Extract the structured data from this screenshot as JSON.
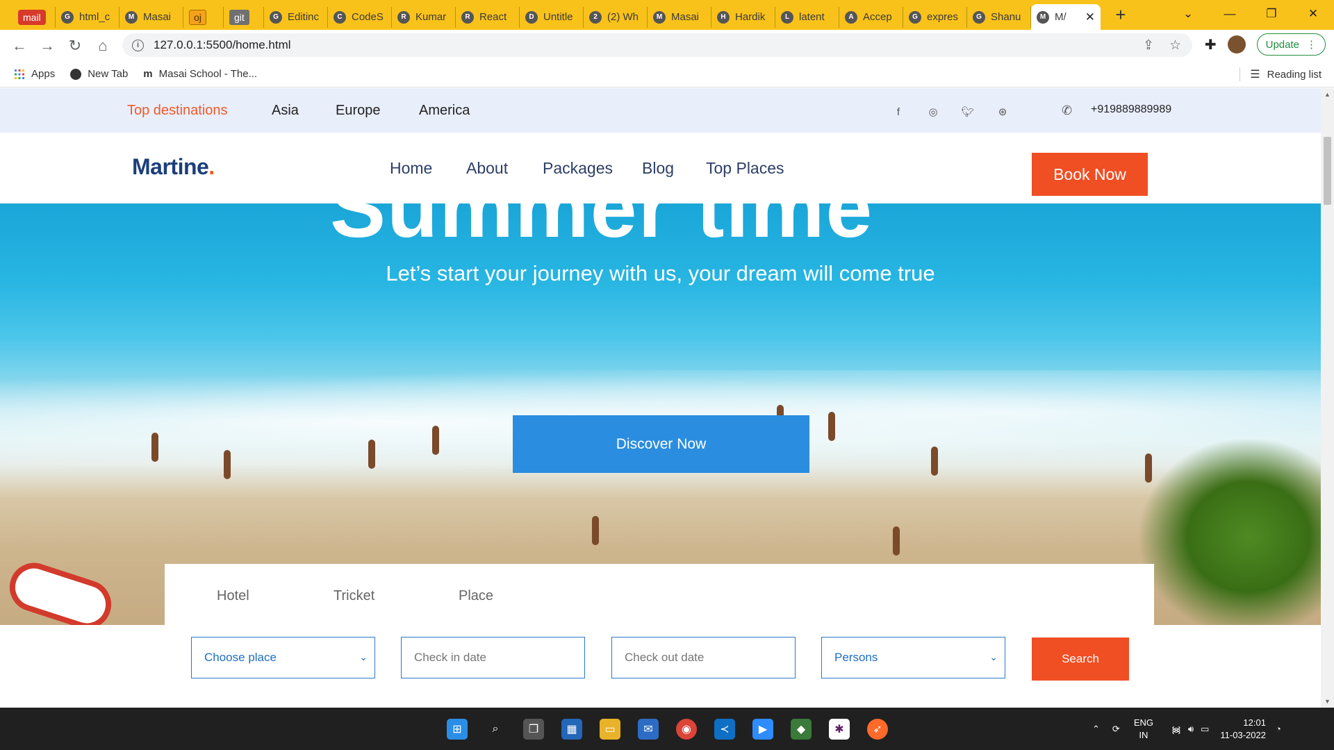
{
  "browser": {
    "tabs": [
      {
        "label": "mail",
        "style": "pill"
      },
      {
        "label": "html_c",
        "icon": "G"
      },
      {
        "label": "Masai",
        "icon": "M"
      },
      {
        "label": "oj",
        "style": "pill-orange"
      },
      {
        "label": "git",
        "style": "pill-grey"
      },
      {
        "label": "Editinc",
        "icon": "G"
      },
      {
        "label": "CodeS",
        "icon": "C"
      },
      {
        "label": "Kumar",
        "icon": "R"
      },
      {
        "label": "React",
        "icon": "R"
      },
      {
        "label": "Untitle",
        "icon": "D"
      },
      {
        "label": "(2) Wh",
        "icon": "2"
      },
      {
        "label": "Masai",
        "icon": "M"
      },
      {
        "label": "Hardik",
        "icon": "H"
      },
      {
        "label": "latent",
        "icon": "L"
      },
      {
        "label": "Accep",
        "icon": "A"
      },
      {
        "label": "expres",
        "icon": "G"
      },
      {
        "label": "Shanu",
        "icon": "G"
      },
      {
        "label": "M/",
        "icon": "M",
        "active": true
      }
    ],
    "url": "127.0.0.1:5500/home.html",
    "update_label": "Update",
    "bookmarks": [
      "Apps",
      "New Tab",
      "Masai School - The..."
    ],
    "reading_list": "Reading list"
  },
  "site": {
    "topbar": {
      "highlight": "Top destinations",
      "regions": [
        "Asia",
        "Europe",
        "America"
      ],
      "phone": "+919889889989",
      "social_icons": [
        "facebook-icon",
        "instagram-icon",
        "twitter-icon",
        "dribbble-icon"
      ],
      "highlight_color": "#f05a28"
    },
    "logo": {
      "text": "Martine",
      "dot": "."
    },
    "nav": [
      "Home",
      "About",
      "Packages",
      "Blog",
      "Top Places"
    ],
    "book_now": "Book Now",
    "hero": {
      "title": "Summer time",
      "subtitle": "Let’s start your journey with us, your dream will come true",
      "cta": "Discover Now"
    },
    "search": {
      "tabs": [
        "Hotel",
        "Tricket",
        "Place"
      ],
      "place_select": "Choose place",
      "checkin_placeholder": "Check in date",
      "checkout_placeholder": "Check out date",
      "persons_select": "Persons",
      "button": "Search"
    },
    "accent_color": "#f04e23",
    "primary_color": "#2a8de0"
  },
  "taskbar": {
    "lang": "ENG",
    "region": "IN",
    "time": "12:01",
    "date": "11-03-2022"
  }
}
